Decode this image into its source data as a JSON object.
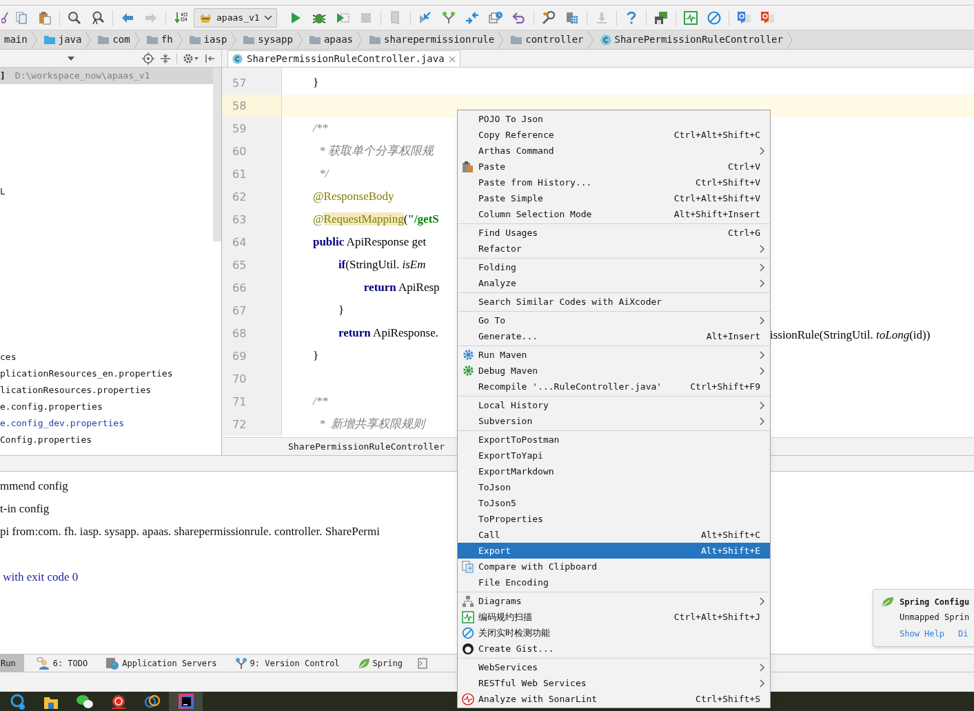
{
  "toolbar": {
    "run_config": "apaas_v1"
  },
  "breadcrumbs": [
    {
      "label": "main",
      "kind": "folder"
    },
    {
      "label": "java",
      "kind": "source_folder"
    },
    {
      "label": "com",
      "kind": "folder"
    },
    {
      "label": "fh",
      "kind": "folder"
    },
    {
      "label": "iasp",
      "kind": "folder"
    },
    {
      "label": "sysapp",
      "kind": "folder"
    },
    {
      "label": "apaas",
      "kind": "folder"
    },
    {
      "label": "sharepermissionrule",
      "kind": "folder"
    },
    {
      "label": "controller",
      "kind": "folder"
    },
    {
      "label": "SharePermissionRuleController",
      "kind": "class"
    }
  ],
  "editor_tab": {
    "label": "SharePermissionRuleController.java",
    "selected": true
  },
  "project_panel": {
    "root_suffix": "]",
    "root_path": "D:\\workspace_now\\apaas_v1",
    "rows": [
      {
        "text": "L",
        "modified": false
      },
      {
        "text": "ces",
        "modified": false
      },
      {
        "text": "plicationResources_en.properties",
        "modified": false
      },
      {
        "text": "licationResources.properties",
        "modified": false
      },
      {
        "text": "e.config.properties",
        "modified": false
      },
      {
        "text": "e.config_dev.properties",
        "modified": true
      },
      {
        "text": "Config.properties",
        "modified": false
      }
    ]
  },
  "editor": {
    "lines": [
      {
        "number": "57",
        "current": false,
        "tokens": [
          {
            "text": "    }",
            "kind": "plain"
          }
        ]
      },
      {
        "number": "58",
        "current": true
      },
      {
        "number": "59",
        "current": false,
        "tokens": [
          {
            "text": "    /**",
            "kind": "comment"
          }
        ]
      },
      {
        "number": "60",
        "current": false,
        "tokens": [
          {
            "text": "     * 获取单个分享权限规",
            "kind": "comment"
          }
        ]
      },
      {
        "number": "61",
        "current": false,
        "tokens": [
          {
            "text": "     */",
            "kind": "comment"
          }
        ]
      },
      {
        "number": "62",
        "current": false,
        "tokens": [
          {
            "text": "    @ResponseBody",
            "kind": "annotation"
          }
        ]
      },
      {
        "number": "63",
        "current": false,
        "tokens": [
          {
            "text": "    @",
            "kind": "annotation"
          },
          {
            "text": "RequestMapping",
            "kind": "annotation_match"
          },
          {
            "text": "(",
            "kind": "plain"
          },
          {
            "text": "\"/getS",
            "kind": "string"
          }
        ]
      },
      {
        "number": "64",
        "current": false,
        "tokens": [
          {
            "text": "    public",
            "kind": "keyword"
          },
          {
            "text": " ApiResponse get",
            "kind": "plain"
          }
        ]
      },
      {
        "number": "65",
        "current": false,
        "tokens": [
          {
            "text": "        if",
            "kind": "keyword"
          },
          {
            "text": "(StringUtil. ",
            "kind": "plain"
          },
          {
            "text": "isEm",
            "kind": "italic"
          }
        ]
      },
      {
        "number": "66",
        "current": false,
        "tokens": [
          {
            "text": "            return",
            "kind": "keyword"
          },
          {
            "text": " ApiResp",
            "kind": "plain"
          }
        ]
      },
      {
        "number": "67",
        "current": false,
        "tokens": [
          {
            "text": "        }",
            "kind": "plain"
          }
        ]
      },
      {
        "number": "68",
        "current": false,
        "tokens": [
          {
            "text": "        return",
            "kind": "keyword"
          },
          {
            "text": " ApiResponse.",
            "kind": "plain"
          }
        ],
        "tail": [
          {
            "text": "issionRule(StringUtil. ",
            "kind": "plain"
          },
          {
            "text": "toLong",
            "kind": "italic"
          },
          {
            "text": "(id))",
            "kind": "plain"
          }
        ]
      },
      {
        "number": "69",
        "current": false,
        "tokens": [
          {
            "text": "    }",
            "kind": "plain"
          }
        ]
      },
      {
        "number": "70",
        "current": false
      },
      {
        "number": "71",
        "current": false,
        "tokens": [
          {
            "text": "    /**",
            "kind": "comment"
          }
        ]
      },
      {
        "number": "72",
        "current": false,
        "tokens": [
          {
            "text": "     *  新增共享权限规则",
            "kind": "comment"
          }
        ]
      }
    ],
    "breadcrumb": "SharePermissionRuleController"
  },
  "console": {
    "lines": [
      {
        "text": "mmend config",
        "kind": "stdout"
      },
      {
        "text": "t-in config",
        "kind": "stdout"
      },
      {
        "text": "pi from:com. fh. iasp. sysapp. apaas. sharepermissionrule. controller. SharePermi",
        "kind": "stdout"
      },
      {
        "text": " with exit code 0",
        "kind": "exit"
      }
    ]
  },
  "tool_windows": [
    {
      "label": "Run",
      "selected": true
    },
    {
      "label": "6: TODO",
      "selected": false
    },
    {
      "label": "Application Servers",
      "selected": false
    },
    {
      "label": "9: Version Control",
      "selected": false
    },
    {
      "label": "Spring",
      "selected": false
    }
  ],
  "notification": {
    "title": "Spring Configu",
    "body": "Unmapped Sprin",
    "actions": [
      "Show Help",
      "Di"
    ]
  },
  "context_menu": {
    "groups": [
      [
        {
          "label": "POJO To Json",
          "selected": false
        },
        {
          "label": "Copy Reference",
          "shortcut": "Ctrl+Alt+Shift+C",
          "selected": false
        },
        {
          "label": "Arthas Command",
          "submenu": true,
          "selected": false
        },
        {
          "label": "Paste",
          "shortcut": "Ctrl+V",
          "selected": false
        },
        {
          "label": "Paste from History...",
          "shortcut": "Ctrl+Shift+V",
          "selected": false
        },
        {
          "label": "Paste Simple",
          "shortcut": "Ctrl+Alt+Shift+V",
          "selected": false
        },
        {
          "label": "Column Selection Mode",
          "shortcut": "Alt+Shift+Insert",
          "selected": false
        }
      ],
      [
        {
          "label": "Find Usages",
          "shortcut": "Ctrl+G",
          "selected": false
        },
        {
          "label": "Refactor",
          "submenu": true,
          "selected": false
        }
      ],
      [
        {
          "label": "Folding",
          "submenu": true,
          "selected": false
        },
        {
          "label": "Analyze",
          "submenu": true,
          "selected": false
        }
      ],
      [
        {
          "label": "Search Similar Codes with AiXcoder",
          "selected": false
        }
      ],
      [
        {
          "label": "Go To",
          "submenu": true,
          "selected": false
        },
        {
          "label": "Generate...",
          "shortcut": "Alt+Insert",
          "selected": false
        }
      ],
      [
        {
          "label": "Run Maven",
          "submenu": true,
          "selected": false
        },
        {
          "label": "Debug Maven",
          "submenu": true,
          "selected": false
        },
        {
          "label": "Recompile '...RuleController.java'",
          "shortcut": "Ctrl+Shift+F9",
          "selected": false
        }
      ],
      [
        {
          "label": "Local History",
          "submenu": true,
          "selected": false
        },
        {
          "label": "Subversion",
          "submenu": true,
          "selected": false
        }
      ],
      [
        {
          "label": "ExportToPostman",
          "selected": false
        },
        {
          "label": "ExportToYapi",
          "selected": false
        },
        {
          "label": "ExportMarkdown",
          "selected": false
        },
        {
          "label": "ToJson",
          "selected": false
        },
        {
          "label": "ToJson5",
          "selected": false
        },
        {
          "label": "ToProperties",
          "selected": false
        },
        {
          "label": "Call",
          "shortcut": "Alt+Shift+C",
          "selected": false
        },
        {
          "label": "Export",
          "shortcut": "Alt+Shift+E",
          "selected": true
        },
        {
          "label": "Compare with Clipboard",
          "selected": false
        },
        {
          "label": "File Encoding",
          "selected": false
        }
      ],
      [
        {
          "label": "Diagrams",
          "submenu": true,
          "selected": false
        },
        {
          "label": "编码规约扫描",
          "shortcut": "Ctrl+Alt+Shift+J",
          "selected": false
        },
        {
          "label": "关闭实时检测功能",
          "selected": false
        },
        {
          "label": "Create Gist...",
          "selected": false
        }
      ],
      [
        {
          "label": "WebServices",
          "submenu": true,
          "selected": false
        },
        {
          "label": "RESTful Web Services",
          "submenu": true,
          "selected": false
        },
        {
          "label": "Analyze with SonarLint",
          "shortcut": "Ctrl+Shift+S",
          "selected": false
        }
      ]
    ]
  }
}
